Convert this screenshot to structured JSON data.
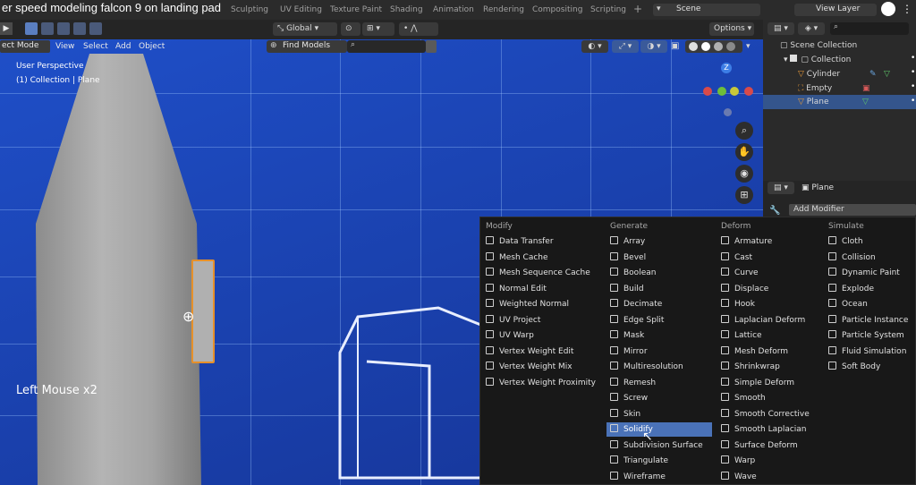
{
  "video_title": "er speed modeling falcon 9 on landing pad",
  "workspace_tabs": [
    "Sculpting",
    "UV Editing",
    "Texture Paint",
    "Shading",
    "Animation",
    "Rendering",
    "Compositing",
    "Scripting"
  ],
  "add_tab": "+",
  "scene": "Scene",
  "view_layer": "View Layer",
  "header": {
    "mode": "ect Mode",
    "menus": [
      "View",
      "Select",
      "Add",
      "Object"
    ],
    "transform_orientation": "Global",
    "find_models": "Find Models",
    "options": "Options"
  },
  "viewport": {
    "perspective": "User Perspective",
    "collection_path": "(1) Collection | Plane",
    "input_display": "Left Mouse x2",
    "gizmo": {
      "z": "Z"
    }
  },
  "outliner": {
    "root": "Scene Collection",
    "collection": "Collection",
    "items": [
      {
        "name": "Cylinder",
        "selected": false
      },
      {
        "name": "Empty",
        "selected": false
      },
      {
        "name": "Plane",
        "selected": true
      }
    ]
  },
  "properties": {
    "object_name": "Plane",
    "add_modifier": "Add Modifier"
  },
  "modifier_menu": {
    "columns": [
      {
        "title": "Modify",
        "items": [
          "Data Transfer",
          "Mesh Cache",
          "Mesh Sequence Cache",
          "Normal Edit",
          "Weighted Normal",
          "UV Project",
          "UV Warp",
          "Vertex Weight Edit",
          "Vertex Weight Mix",
          "Vertex Weight Proximity"
        ]
      },
      {
        "title": "Generate",
        "items": [
          "Array",
          "Bevel",
          "Boolean",
          "Build",
          "Decimate",
          "Edge Split",
          "Mask",
          "Mirror",
          "Multiresolution",
          "Remesh",
          "Screw",
          "Skin",
          "Solidify",
          "Subdivision Surface",
          "Triangulate",
          "Wireframe"
        ]
      },
      {
        "title": "Deform",
        "items": [
          "Armature",
          "Cast",
          "Curve",
          "Displace",
          "Hook",
          "Laplacian Deform",
          "Lattice",
          "Mesh Deform",
          "Shrinkwrap",
          "Simple Deform",
          "Smooth",
          "Smooth Corrective",
          "Smooth Laplacian",
          "Surface Deform",
          "Warp",
          "Wave"
        ]
      },
      {
        "title": "Simulate",
        "items": [
          "Cloth",
          "Collision",
          "Dynamic Paint",
          "Explode",
          "Ocean",
          "Particle Instance",
          "Particle System",
          "Fluid Simulation",
          "Soft Body"
        ]
      }
    ],
    "highlighted": "Solidify"
  },
  "colors": {
    "accent": "#4a72b8",
    "viewport_bg": "#1f4fc8",
    "highlight_row": "#34558c"
  }
}
